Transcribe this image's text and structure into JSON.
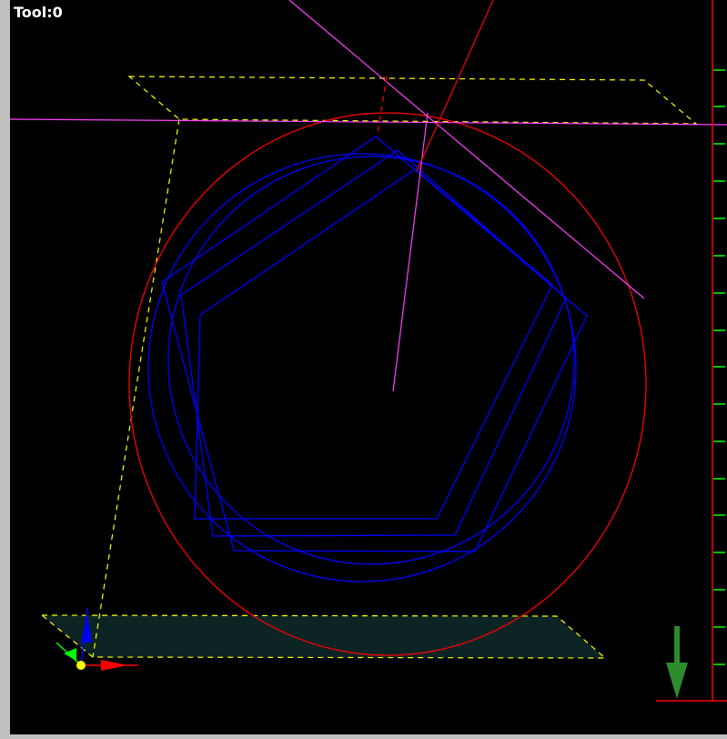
{
  "viewport": {
    "tool_label": "Tool:0",
    "background_color": "#000000",
    "border_color": "#c0c0c0"
  },
  "colors": {
    "stock_outline": "#ffff00",
    "stock_fill": "#0c2424",
    "toolpath": "#0000ff",
    "tool_circle": "#ff0000",
    "red_line": "#ff0000",
    "magenta_line": "#ff40ff",
    "ruler": "#ff0000",
    "ruler_ticks": "#00ff00",
    "view_arrow": "#2e8b2e",
    "axis_x": "#ff0000",
    "axis_y": "#00ff00",
    "axis_z": "#0000ff",
    "axis_origin": "#ffff00"
  },
  "icons": {
    "view_direction": "arrow-down-icon",
    "axis_triad": "axis-triad-icon"
  }
}
